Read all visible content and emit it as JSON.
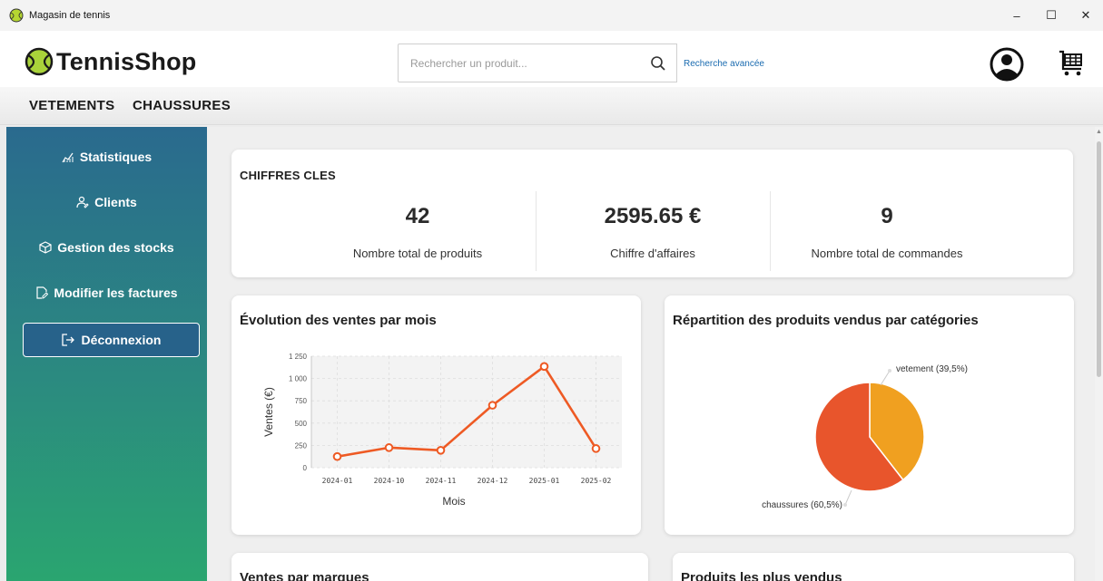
{
  "window": {
    "title": "Magasin de tennis",
    "minimize": "–",
    "maximize": "☐",
    "close": "✕"
  },
  "header": {
    "logo_text": "TennisShop",
    "search_placeholder": "Rechercher un produit...",
    "search_value": "",
    "advanced_search": "Recherche avancée"
  },
  "nav": {
    "items": [
      "VETEMENTS",
      "CHAUSSURES"
    ]
  },
  "sidebar": {
    "items": [
      {
        "label": "Statistiques",
        "icon": "chart-icon"
      },
      {
        "label": "Clients",
        "icon": "users-icon"
      },
      {
        "label": "Gestion des stocks",
        "icon": "box-icon"
      },
      {
        "label": "Modifier les factures",
        "icon": "edit-document-icon"
      }
    ],
    "logout": "Déconnexion"
  },
  "kpis": {
    "title": "CHIFFRES CLES",
    "items": [
      {
        "value": "42",
        "label": "Nombre total de produits"
      },
      {
        "value": "2595.65 €",
        "label": "Chiffre d'affaires"
      },
      {
        "value": "9",
        "label": "Nombre total de commandes"
      }
    ]
  },
  "cards": {
    "sales_title": "Évolution des ventes par mois",
    "pie_title": "Répartition des produits vendus par catégories",
    "brands_title": "Ventes par marques",
    "top_products_title": "Produits les plus vendus"
  },
  "colors": {
    "line": "#ee5a24",
    "pie_vetement": "#f0a020",
    "pie_chaussures": "#e8552c",
    "sidebar_top": "#2a6a8e",
    "sidebar_bottom": "#2aa570"
  },
  "chart_data": [
    {
      "type": "line",
      "title": "Évolution des ventes par mois",
      "xlabel": "Mois",
      "ylabel": "Ventes (€)",
      "categories": [
        "2024-01",
        "2024-10",
        "2024-11",
        "2024-12",
        "2025-01",
        "2025-02"
      ],
      "series": [
        {
          "values": [
            125,
            225,
            195,
            700,
            1135,
            215
          ]
        }
      ],
      "ylim": [
        0,
        1250
      ],
      "yticks": [
        0,
        250,
        500,
        750,
        1000,
        1250
      ],
      "ytick_labels": [
        "0",
        "250",
        "500",
        "750",
        "1 000",
        "1 250"
      ],
      "grid": true
    },
    {
      "type": "pie",
      "title": "Répartition des produits vendus par catégories",
      "slices": [
        {
          "label": "vetement (39,5%)",
          "value": 39.5,
          "color": "#f0a020"
        },
        {
          "label": "chaussures (60,5%)",
          "value": 60.5,
          "color": "#e8552c"
        }
      ]
    }
  ]
}
